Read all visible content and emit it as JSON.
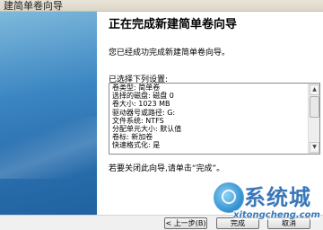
{
  "window": {
    "title": "建简单卷向导"
  },
  "wizard": {
    "heading": "正在完成新建简单卷向导",
    "intro": "您已经成功完成新建简单卷向导。",
    "settings_label": "已选择下列设置:",
    "settings": [
      "卷类型: 简单卷",
      "选择的磁盘: 磁盘 0",
      "卷大小: 1023 MB",
      "驱动器号或路径: G:",
      "文件系统: NTFS",
      "分配单元大小: 默认值",
      "卷标: 新加卷",
      "快速格式化: 是"
    ],
    "close_hint": "若要关闭此向导,请单击“完成”。"
  },
  "buttons": {
    "back": "< 上一步(B)",
    "finish": "完成",
    "cancel": "取消"
  },
  "scrollbar": {
    "up_icon": "▲",
    "down_icon": "▼"
  },
  "watermark": {
    "title": "系统城",
    "url": "xitongcheng.com"
  }
}
